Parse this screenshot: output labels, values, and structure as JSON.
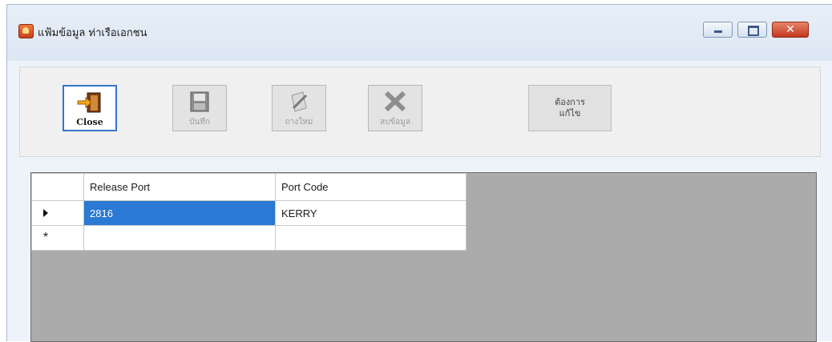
{
  "window": {
    "title": "แฟ้มข้อมูล ท่าเรือเอกชน"
  },
  "toolbar": {
    "close_label": "Close",
    "save_label": "บันทึก",
    "new_label": "ถางใหม่",
    "delete_label": "ลบข้อมูล",
    "edit_label": "ต้องการ\nแก้ไข"
  },
  "grid": {
    "columns": [
      "Release Port",
      "Port Code"
    ],
    "rows": [
      {
        "release_port": "2816",
        "port_code": "KERRY"
      }
    ],
    "new_row_marker": "*"
  },
  "colors": {
    "selection": "#2a79d4",
    "grid_background": "#ababab",
    "close_button": "#c2371d"
  }
}
